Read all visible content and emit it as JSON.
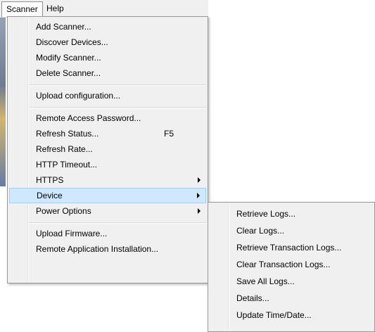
{
  "menubar": {
    "items": [
      {
        "label": "Scanner"
      },
      {
        "label": "Help"
      }
    ]
  },
  "scanner_menu": {
    "items": [
      {
        "label": "Add Scanner..."
      },
      {
        "label": "Discover Devices..."
      },
      {
        "label": "Modify Scanner..."
      },
      {
        "label": "Delete Scanner..."
      },
      {
        "label": "Upload configuration..."
      },
      {
        "label": "Remote Access Password..."
      },
      {
        "label": "Refresh Status...",
        "shortcut": "F5"
      },
      {
        "label": "Refresh Rate..."
      },
      {
        "label": "HTTP Timeout..."
      },
      {
        "label": "HTTPS"
      },
      {
        "label": "Device"
      },
      {
        "label": "Power Options"
      },
      {
        "label": "Upload Firmware..."
      },
      {
        "label": "Remote Application Installation..."
      }
    ]
  },
  "device_submenu": {
    "items": [
      {
        "label": "Retrieve Logs..."
      },
      {
        "label": "Clear Logs..."
      },
      {
        "label": "Retrieve Transaction Logs..."
      },
      {
        "label": "Clear Transaction Logs..."
      },
      {
        "label": "Save All Logs..."
      },
      {
        "label": "Details..."
      },
      {
        "label": "Update Time/Date..."
      }
    ]
  },
  "colors": {
    "menu_bg": "#f0f0f0",
    "highlight_bg": "#cde8ff",
    "highlight_border": "#99d1ff"
  }
}
